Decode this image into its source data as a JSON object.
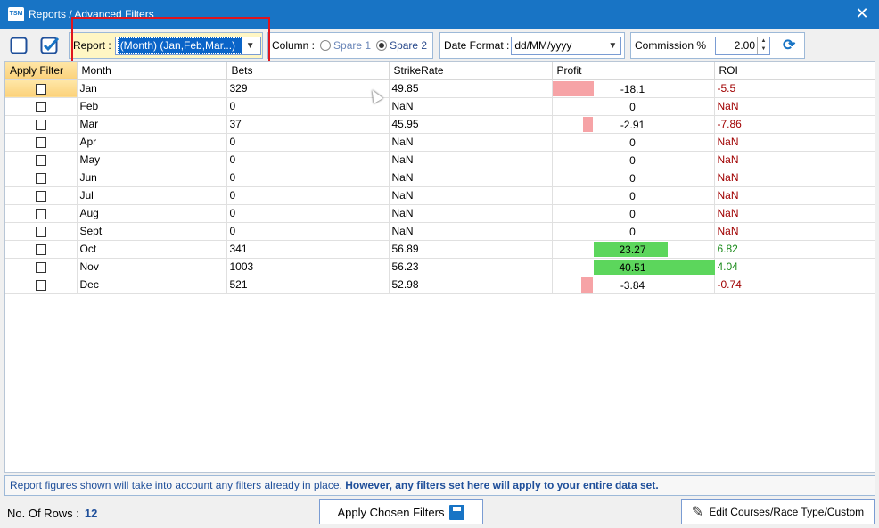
{
  "window": {
    "app_icon": "TSM",
    "title": "Reports / Advanced Filters",
    "close_glyph": "✕"
  },
  "toolbar": {
    "report_label": "Report :",
    "report_value": "(Month) (Jan,Feb,Mar...)",
    "column_label": "Column :",
    "spare1": "Spare 1",
    "spare2": "Spare 2",
    "date_format_label": "Date Format :",
    "date_format_value": "dd/MM/yyyy",
    "commission_label": "Commission %",
    "commission_value": "2.00"
  },
  "grid": {
    "columns": [
      "Apply Filter",
      "Month",
      "Bets",
      "StrikeRate",
      "Profit",
      "ROI"
    ],
    "rows": [
      {
        "month": "Jan",
        "bets": "329",
        "strike": "49.85",
        "profit": "-18.1",
        "roi": "-5.5"
      },
      {
        "month": "Feb",
        "bets": "0",
        "strike": "NaN",
        "profit": "0",
        "roi": "NaN"
      },
      {
        "month": "Mar",
        "bets": "37",
        "strike": "45.95",
        "profit": "-2.91",
        "roi": "-7.86"
      },
      {
        "month": "Apr",
        "bets": "0",
        "strike": "NaN",
        "profit": "0",
        "roi": "NaN"
      },
      {
        "month": "May",
        "bets": "0",
        "strike": "NaN",
        "profit": "0",
        "roi": "NaN"
      },
      {
        "month": "Jun",
        "bets": "0",
        "strike": "NaN",
        "profit": "0",
        "roi": "NaN"
      },
      {
        "month": "Jul",
        "bets": "0",
        "strike": "NaN",
        "profit": "0",
        "roi": "NaN"
      },
      {
        "month": "Aug",
        "bets": "0",
        "strike": "NaN",
        "profit": "0",
        "roi": "NaN"
      },
      {
        "month": "Sept",
        "bets": "0",
        "strike": "NaN",
        "profit": "0",
        "roi": "NaN"
      },
      {
        "month": "Oct",
        "bets": "341",
        "strike": "56.89",
        "profit": "23.27",
        "roi": "6.82"
      },
      {
        "month": "Nov",
        "bets": "1003",
        "strike": "56.23",
        "profit": "40.51",
        "roi": "4.04"
      },
      {
        "month": "Dec",
        "bets": "521",
        "strike": "52.98",
        "profit": "-3.84",
        "roi": "-0.74"
      }
    ]
  },
  "info": {
    "note": "Report figures shown will take into account any filters already in place.",
    "note_bold": "However, any filters set here will apply to your entire data set."
  },
  "footer": {
    "rows_label": "No. Of Rows :",
    "rows_count": "12",
    "apply_button": "Apply Chosen Filters",
    "edit_button": "Edit Courses/Race Type/Custom"
  },
  "colors": {
    "titlebar": "#1874c5",
    "profit_negative": "#f6a3a6",
    "profit_positive": "#5cd65c",
    "highlight": "#e0141e"
  }
}
